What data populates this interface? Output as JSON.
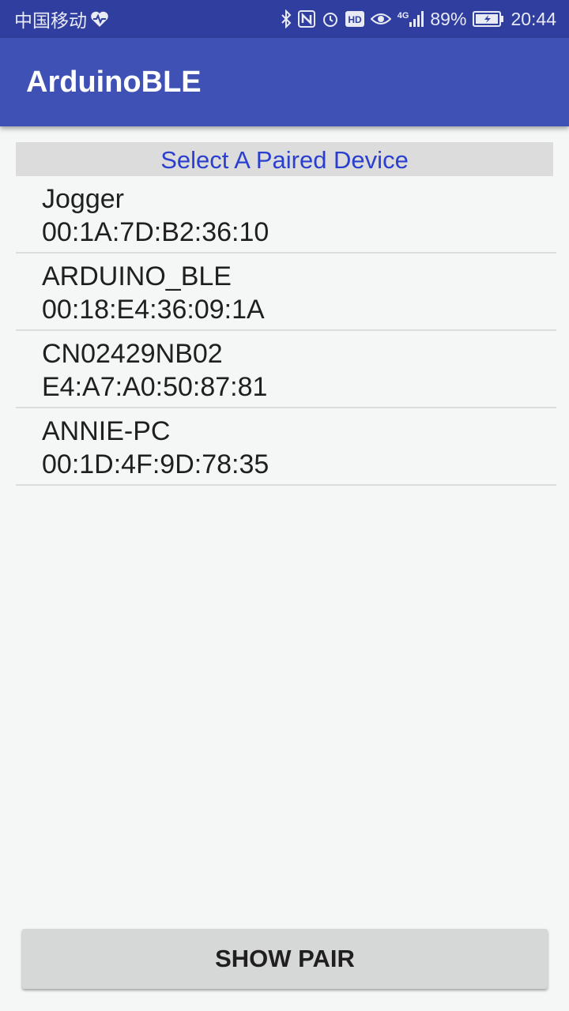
{
  "status_bar": {
    "carrier": "中国移动",
    "network": "4G",
    "battery_percent": "89%",
    "time": "20:44",
    "icons": [
      "heart-rate-icon",
      "bluetooth-icon",
      "nfc-icon",
      "alarm-icon",
      "hd-icon",
      "eye-icon",
      "signal-icon",
      "battery-icon"
    ]
  },
  "app_bar": {
    "title": "ArduinoBLE"
  },
  "list": {
    "header": "Select A Paired Device",
    "devices": [
      {
        "name": "Jogger",
        "address": "00:1A:7D:B2:36:10"
      },
      {
        "name": "ARDUINO_BLE",
        "address": "00:18:E4:36:09:1A"
      },
      {
        "name": "CN02429NB02",
        "address": "E4:A7:A0:50:87:81"
      },
      {
        "name": "ANNIE-PC",
        "address": "00:1D:4F:9D:78:35"
      }
    ]
  },
  "footer": {
    "show_pair_label": "SHOW PAIR"
  },
  "colors": {
    "status_bar": "#303f9f",
    "app_bar": "#3f51b5",
    "header_text": "#2b3fcf",
    "header_background": "#dcdcdc",
    "background": "#f5f7f7"
  }
}
